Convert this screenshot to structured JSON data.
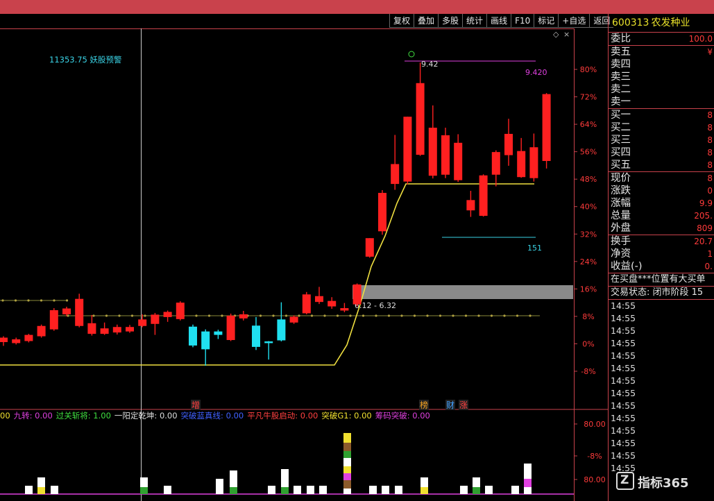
{
  "toolbar": [
    "复权",
    "叠加",
    "多股",
    "统计",
    "画线",
    "F10",
    "标记",
    "+自选",
    "返回"
  ],
  "warning_label": "11353.75 妖股预警",
  "stock": {
    "code": "600313",
    "name": "农发种业"
  },
  "quote_panel": {
    "weibi": {
      "label": "委比",
      "value": "100.0"
    },
    "sell": [
      {
        "label": "卖五",
        "value": "¥"
      },
      {
        "label": "卖四",
        "value": ""
      },
      {
        "label": "卖三",
        "value": ""
      },
      {
        "label": "卖二",
        "value": ""
      },
      {
        "label": "卖一",
        "value": ""
      }
    ],
    "buy": [
      {
        "label": "买一",
        "value": "8"
      },
      {
        "label": "买二",
        "value": "8"
      },
      {
        "label": "买三",
        "value": "8"
      },
      {
        "label": "买四",
        "value": "8"
      },
      {
        "label": "买五",
        "value": "8"
      }
    ],
    "stats": [
      {
        "label": "现价",
        "value": "8"
      },
      {
        "label": "涨跌",
        "value": "0"
      },
      {
        "label": "涨幅",
        "value": "9.9"
      },
      {
        "label": "总量",
        "value": "205."
      },
      {
        "label": "外盘",
        "value": "809"
      }
    ],
    "stats2": [
      {
        "label": "换手",
        "value": "20.7"
      },
      {
        "label": "净资",
        "value": "1"
      },
      {
        "label": "收益(-)",
        "value": "0."
      }
    ],
    "note": "在买盘***位置有大买单",
    "trade_status": "交易状态: 闭市阶段 15"
  },
  "ticks": [
    "14:55",
    "14:55",
    "14:55",
    "14:55",
    "14:55",
    "14:55",
    "14:55",
    "14:55",
    "14:55",
    "14:55",
    "14:55",
    "14:55",
    "14:55",
    "14:55"
  ],
  "indicators": [
    {
      "text": "00",
      "color": "#f0e030"
    },
    {
      "text": "九转: 0.00",
      "color": "#e040e0"
    },
    {
      "text": "过关斩将: 1.00",
      "color": "#40e040"
    },
    {
      "text": "一阳定乾坤: 0.00",
      "color": "#dddddd"
    },
    {
      "text": "突破蓝真线: 0.00",
      "color": "#4060ff"
    },
    {
      "text": "平凡牛股启动: 0.00",
      "color": "#ff4040"
    },
    {
      "text": "突破G1: 0.00",
      "color": "#f0e030"
    },
    {
      "text": "筹码突破: 0.00",
      "color": "#e040e0"
    }
  ],
  "logo_text": "指标365",
  "chart_data": {
    "type": "candlestick",
    "y_axis_ticks": [
      "80%",
      "72%",
      "64%",
      "56%",
      "48%",
      "40%",
      "32%",
      "24%",
      "16%",
      "8%",
      "0%",
      "-8%"
    ],
    "y_range": [
      -8,
      80
    ],
    "candles": [
      {
        "o": 0.5,
        "c": 1.8,
        "h": 2.2,
        "l": -0.6
      },
      {
        "o": 1.3,
        "c": 0.2,
        "h": 1.8,
        "l": -0.2
      },
      {
        "o": 0.8,
        "c": 2.6,
        "h": 2.9,
        "l": 0.4
      },
      {
        "o": 2.2,
        "c": 5.2,
        "h": 5.6,
        "l": 1.8
      },
      {
        "o": 4.2,
        "c": 9.8,
        "h": 10.4,
        "l": 3.8
      },
      {
        "o": 8.6,
        "c": 10.3,
        "h": 10.8,
        "l": 8.0
      },
      {
        "o": 5.2,
        "c": 13.1,
        "h": 14.6,
        "l": 4.8
      },
      {
        "o": 6.0,
        "c": 2.9,
        "h": 8.4,
        "l": 2.4
      },
      {
        "o": 2.9,
        "c": 4.5,
        "h": 6.2,
        "l": 2.6
      },
      {
        "o": 3.3,
        "c": 4.9,
        "h": 5.6,
        "l": 2.7
      },
      {
        "o": 3.6,
        "c": 4.9,
        "h": 5.5,
        "l": 3.2
      },
      {
        "o": 5.2,
        "c": 7.1,
        "h": 8.6,
        "l": 4.8
      },
      {
        "o": 5.8,
        "c": 8.5,
        "h": 9.0,
        "l": 2.6
      },
      {
        "o": 7.8,
        "c": 9.3,
        "h": 9.7,
        "l": 6.4
      },
      {
        "o": 7.2,
        "c": 12.0,
        "h": 12.4,
        "l": 6.8
      },
      {
        "o": 5.0,
        "c": -0.5,
        "h": 5.6,
        "l": -1.0,
        "cyan": true
      },
      {
        "o": 3.6,
        "c": -1.6,
        "h": 4.2,
        "l": -6.4,
        "cyan": true
      },
      {
        "o": 3.6,
        "c": 2.6,
        "h": 4.1,
        "l": 1.4,
        "cyan": true
      },
      {
        "o": 1.1,
        "c": 8.2,
        "h": 8.8,
        "l": 0.8
      },
      {
        "o": 7.4,
        "c": 8.6,
        "h": 9.6,
        "l": 6.8
      },
      {
        "o": 5.3,
        "c": -0.9,
        "h": 7.8,
        "l": -1.8,
        "cyan": true
      },
      {
        "o": 0.7,
        "c": 0.2,
        "h": 0.8,
        "l": -4.6,
        "cyan": true
      },
      {
        "o": 1.0,
        "c": 7.1,
        "h": 12.1,
        "l": 0.7,
        "cyan": true
      },
      {
        "o": 6.2,
        "c": 7.9,
        "h": 8.3,
        "l": 5.8
      },
      {
        "o": 8.9,
        "c": 14.4,
        "h": 15.1,
        "l": 8.6
      },
      {
        "o": 12.2,
        "c": 13.9,
        "h": 16.6,
        "l": 11.6
      },
      {
        "o": 12.5,
        "c": 10.9,
        "h": 13.6,
        "l": 10.2
      },
      {
        "o": 9.7,
        "c": 10.4,
        "h": 11.9,
        "l": 9.2
      },
      {
        "o": 11.5,
        "c": 17.3,
        "h": 17.6,
        "l": 10.9
      },
      {
        "o": 25.4,
        "c": 30.8,
        "h": 30.8,
        "l": 25.1
      },
      {
        "o": 32.8,
        "c": 44.0,
        "h": 44.8,
        "l": 31.8
      },
      {
        "o": 46.6,
        "c": 52.4,
        "h": 60.9,
        "l": 44.9
      },
      {
        "o": 47.3,
        "c": 66.2,
        "h": 66.2,
        "l": 46.5
      },
      {
        "o": 55.1,
        "c": 76.0,
        "h": 82.0,
        "l": 54.8
      },
      {
        "o": 63.0,
        "c": 49.0,
        "h": 69.5,
        "l": 48.2
      },
      {
        "o": 60.8,
        "c": 49.3,
        "h": 63.0,
        "l": 48.3
      },
      {
        "o": 58.6,
        "c": 47.7,
        "h": 61.1,
        "l": 47.2
      },
      {
        "o": 38.9,
        "c": 41.9,
        "h": 44.6,
        "l": 37.0
      },
      {
        "o": 37.3,
        "c": 49.1,
        "h": 49.4,
        "l": 37.1
      },
      {
        "o": 49.3,
        "c": 55.9,
        "h": 56.4,
        "l": 45.9
      },
      {
        "o": 55.0,
        "c": 61.2,
        "h": 65.6,
        "l": 51.9
      },
      {
        "o": 56.2,
        "c": 48.6,
        "h": 60.0,
        "l": 48.4
      },
      {
        "o": 48.3,
        "c": 57.3,
        "h": 61.3,
        "l": 47.3
      },
      {
        "o": 53.3,
        "c": 72.8,
        "h": 73.1,
        "l": 51.1
      }
    ],
    "annotations": {
      "high_label": "9.42",
      "right_label": "9.420",
      "low_label": "151",
      "zone_label": "6.12 - 6.32",
      "bottom_marks": [
        {
          "text": "增",
          "color": "#ff4040"
        },
        {
          "text": "榜",
          "color": "#f0a020"
        },
        {
          "text": "财",
          "color": "#40a0ff"
        },
        {
          "text": "涨",
          "color": "#ff4040"
        }
      ]
    },
    "indicator_y_ticks": [
      "80.00",
      "-8%",
      "80.00"
    ]
  }
}
